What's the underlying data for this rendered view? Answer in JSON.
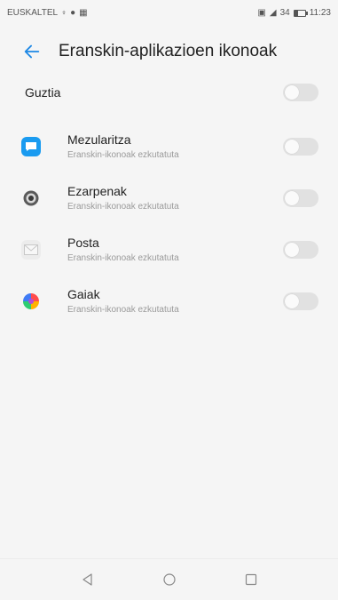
{
  "status_bar": {
    "carrier": "EUSKALTEL",
    "battery_percent_text": "34",
    "time": "11:23",
    "battery_level": 0.34
  },
  "header": {
    "title": "Eranskin-aplikazioen ikonoak",
    "back_icon": "arrow-left-icon",
    "accent_color": "#1e88e5"
  },
  "all_row": {
    "label": "Guztia",
    "enabled": false
  },
  "apps": [
    {
      "name": "Mezularitza",
      "subtitle": "Eranskin-ikonoak ezkutatuta",
      "icon": "messaging-icon",
      "icon_color": "#1a9bf0",
      "enabled": false
    },
    {
      "name": "Ezarpenak",
      "subtitle": "Eranskin-ikonoak ezkutatuta",
      "icon": "settings-gear-icon",
      "icon_color": "#4a4a4a",
      "enabled": false
    },
    {
      "name": "Posta",
      "subtitle": "Eranskin-ikonoak ezkutatuta",
      "icon": "mail-icon",
      "icon_color": "#e8e8e8",
      "enabled": false
    },
    {
      "name": "Gaiak",
      "subtitle": "Eranskin-ikonoak ezkutatuta",
      "icon": "themes-icon",
      "icon_color": "#ff5b5b",
      "enabled": false
    }
  ],
  "navigation": {
    "back_icon": "nav-back-triangle-icon",
    "home_icon": "nav-home-circle-icon",
    "recents_icon": "nav-recents-square-icon"
  }
}
